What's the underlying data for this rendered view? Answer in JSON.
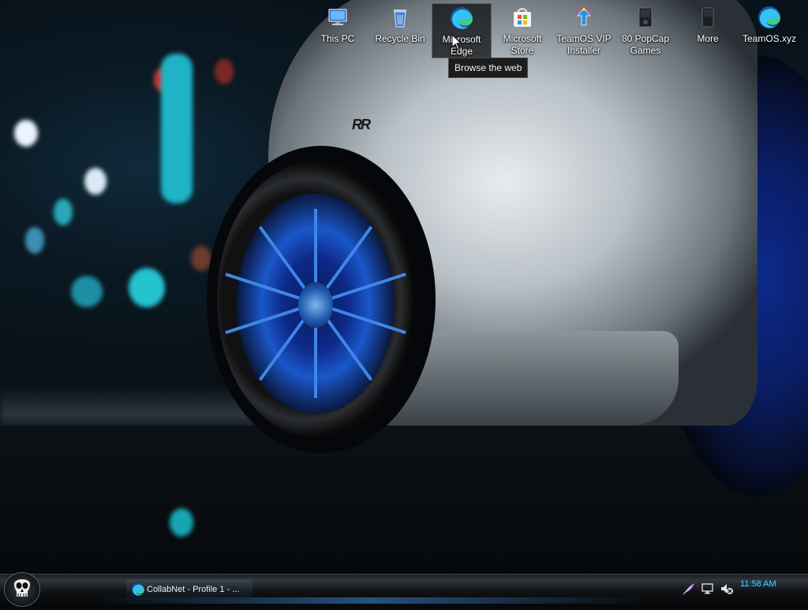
{
  "desktop": {
    "icons": [
      {
        "label": "This PC",
        "icon": "this-pc-icon"
      },
      {
        "label": "Recycle Bin",
        "icon": "recycle-bin-icon"
      },
      {
        "label": "Microsoft Edge",
        "icon": "edge-icon",
        "selected": true
      },
      {
        "label": "Microsoft Store",
        "icon": "store-icon"
      },
      {
        "label": "TeamOS VIP Installer",
        "icon": "installer-icon"
      },
      {
        "label": "80 PopCap Games",
        "icon": "popcap-icon"
      },
      {
        "label": "More",
        "icon": "more-icon"
      },
      {
        "label": "TeamOS.xyz",
        "icon": "edge-icon"
      }
    ],
    "tooltip": "Browse the web"
  },
  "taskbar": {
    "start_icon": "skull-start-icon",
    "window_button": {
      "label": "CollabNet - Profile 1 - ...",
      "icon": "edge-icon"
    },
    "tray": [
      {
        "icon": "feather-icon"
      },
      {
        "icon": "network-icon"
      },
      {
        "icon": "volume-muted-icon"
      }
    ],
    "clock": "11:58 AM"
  },
  "colors": {
    "accent": "#4ad0ff",
    "rim_blue": "#1a57c9"
  }
}
